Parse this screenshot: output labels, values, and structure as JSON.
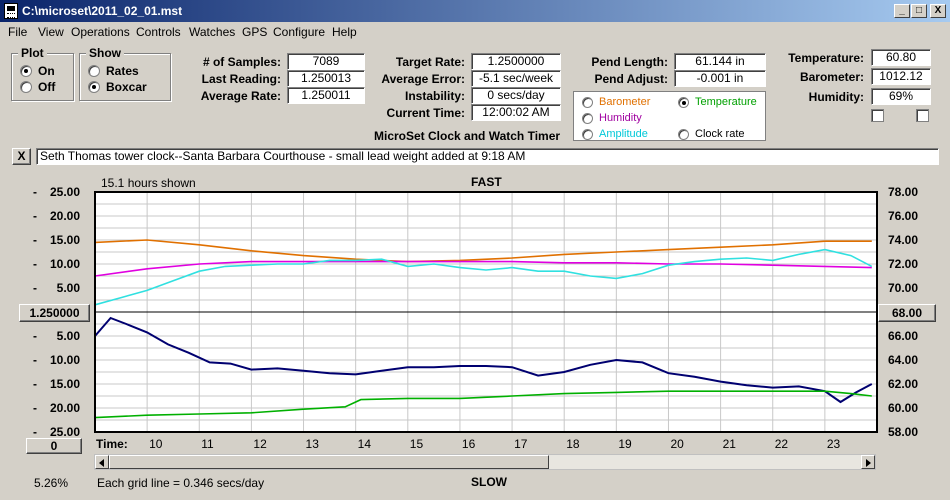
{
  "window": {
    "title": "C:\\microset\\2011_02_01.mst",
    "minimize": "_",
    "maximize": "□",
    "close": "X"
  },
  "menu": [
    "File",
    "View",
    "Operations",
    "Controls",
    "Watches",
    "GPS",
    "Configure",
    "Help"
  ],
  "plot_group": {
    "title": "Plot",
    "on": "On",
    "off": "Off",
    "selected": "On"
  },
  "show_group": {
    "title": "Show",
    "rates": "Rates",
    "boxcar": "Boxcar",
    "selected": "Boxcar"
  },
  "stats": {
    "samples_label": "# of Samples:",
    "samples": "7089",
    "last_reading_label": "Last Reading:",
    "last_reading": "1.250013",
    "average_rate_label": "Average Rate:",
    "average_rate": "1.250011",
    "target_rate_label": "Target Rate:",
    "target_rate": "1.2500000",
    "average_error_label": "Average Error:",
    "average_error": "-5.1 sec/week",
    "instability_label": "Instability:",
    "instability": "0 secs/day",
    "current_time_label": "Current Time:",
    "current_time": "12:00:02 AM",
    "pend_length_label": "Pend Length:",
    "pend_length": "61.144 in",
    "pend_adjust_label": "Pend Adjust:",
    "pend_adjust": "-0.001 in",
    "temperature_label": "Temperature:",
    "temperature": "60.80",
    "barometer_label": "Barometer:",
    "barometer": "1012.12",
    "humidity_label": "Humidity:",
    "humidity": "69%"
  },
  "app_caption": "MicroSet Clock and Watch Timer",
  "plot_select": {
    "barometer": "Barometer",
    "temperature": "Temperature",
    "humidity": "Humidity",
    "amplitude": "Amplitude",
    "clock_rate": "Clock rate",
    "selected": "Temperature",
    "colors": {
      "barometer": "#e07000",
      "temperature": "#00a000",
      "humidity": "#a000a0",
      "amplitude": "#00c8d8",
      "clock_rate": "#000000"
    }
  },
  "note": {
    "close": "X",
    "text": "Seth Thomas tower clock--Santa Barbara Courthouse - small lead weight added at 9:18 AM"
  },
  "chart_header": {
    "hours_shown": "15.1 hours shown",
    "fast": "FAST",
    "slow": "SLOW",
    "grid_info": "Each grid line = 0.346 secs/day",
    "percent": "5.26%"
  },
  "left_buttons": {
    "center_rate": "1.250000",
    "zero": "0"
  },
  "right_button": "68.00",
  "chart_data": {
    "type": "line",
    "x_label": "Time:",
    "x_ticks": [
      "10",
      "11",
      "12",
      "13",
      "14",
      "15",
      "16",
      "17",
      "18",
      "19",
      "20",
      "21",
      "22",
      "23"
    ],
    "x_range": [
      9.0,
      24.0
    ],
    "left_axis_ticks": [
      "25.00",
      "20.00",
      "15.00",
      "10.00",
      "5.00",
      "",
      "5.00",
      "10.00",
      "15.00",
      "20.00",
      "25.00"
    ],
    "right_axis_ticks": [
      "78.00",
      "76.00",
      "74.00",
      "72.00",
      "70.00",
      "68.00",
      "66.00",
      "64.00",
      "62.00",
      "60.00",
      "58.00"
    ],
    "right_range": [
      58.0,
      78.0
    ],
    "series": [
      {
        "color": "#e07000",
        "x": [
          9.0,
          10.0,
          11.0,
          12.0,
          13.0,
          14.0,
          15.0,
          16.0,
          17.0,
          18.0,
          19.0,
          20.0,
          21.0,
          22.0,
          23.0,
          23.9
        ],
        "y": [
          73.8,
          74.0,
          73.6,
          73.1,
          72.7,
          72.4,
          72.2,
          72.3,
          72.5,
          72.8,
          73.0,
          73.2,
          73.4,
          73.6,
          73.9,
          73.9
        ]
      },
      {
        "color": "#e000e0",
        "x": [
          9.0,
          10.0,
          11.0,
          12.0,
          13.0,
          14.0,
          15.0,
          16.0,
          17.0,
          18.0,
          19.0,
          20.0,
          21.0,
          22.0,
          23.0,
          23.9
        ],
        "y": [
          71.0,
          71.6,
          72.0,
          72.2,
          72.2,
          72.2,
          72.2,
          72.2,
          72.2,
          72.1,
          72.1,
          72.0,
          72.0,
          71.9,
          71.8,
          71.7
        ]
      },
      {
        "color": "#30e0e0",
        "x": [
          9.0,
          9.5,
          10.0,
          10.5,
          11.0,
          11.5,
          12.0,
          12.5,
          13.0,
          13.5,
          14.0,
          14.5,
          15.0,
          15.5,
          16.0,
          16.5,
          17.0,
          17.5,
          18.0,
          18.5,
          19.0,
          19.5,
          20.0,
          20.5,
          21.0,
          21.5,
          22.0,
          22.5,
          23.0,
          23.5,
          23.9
        ],
        "y": [
          68.6,
          69.2,
          69.8,
          70.6,
          71.4,
          71.8,
          71.9,
          72.0,
          72.0,
          72.3,
          72.3,
          72.4,
          71.8,
          72.0,
          71.7,
          71.5,
          71.7,
          71.4,
          71.4,
          71.0,
          70.8,
          71.2,
          71.9,
          72.2,
          72.4,
          72.5,
          72.3,
          72.8,
          73.2,
          72.7,
          71.8
        ]
      },
      {
        "color": "#000070",
        "x": [
          9.0,
          9.3,
          9.6,
          10.0,
          10.4,
          10.8,
          11.2,
          11.6,
          12.0,
          12.5,
          13.0,
          13.5,
          14.0,
          14.5,
          15.0,
          15.5,
          16.0,
          16.5,
          17.0,
          17.5,
          18.0,
          18.5,
          19.0,
          19.5,
          20.0,
          20.5,
          21.0,
          21.5,
          22.0,
          22.5,
          23.0,
          23.3,
          23.6,
          23.9
        ],
        "y": [
          66.0,
          67.5,
          67.0,
          66.3,
          65.3,
          64.6,
          63.8,
          63.7,
          63.2,
          63.3,
          63.1,
          62.9,
          62.8,
          63.1,
          63.4,
          63.4,
          63.5,
          63.5,
          63.4,
          62.7,
          63.0,
          63.6,
          64.0,
          63.8,
          62.9,
          62.6,
          62.2,
          61.9,
          61.7,
          61.8,
          61.4,
          60.5,
          61.3,
          62.0
        ]
      },
      {
        "color": "#00b000",
        "x": [
          9.0,
          10.0,
          11.0,
          12.0,
          13.0,
          13.8,
          14.1,
          15.0,
          16.0,
          17.0,
          18.0,
          19.0,
          20.0,
          21.0,
          22.0,
          23.0,
          23.5,
          23.9
        ],
        "y": [
          59.2,
          59.4,
          59.5,
          59.6,
          59.9,
          60.1,
          60.7,
          60.8,
          60.8,
          61.0,
          61.2,
          61.3,
          61.4,
          61.4,
          61.4,
          61.4,
          61.2,
          61.0
        ]
      }
    ]
  }
}
